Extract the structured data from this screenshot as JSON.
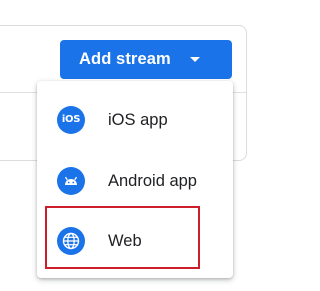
{
  "toolbar": {
    "add_stream_label": "Add stream",
    "add_stream_caret_icon": "arrow-drop-down-icon"
  },
  "menu": {
    "items": [
      {
        "label": "iOS app",
        "icon": "ios-icon",
        "icon_text": "iOS"
      },
      {
        "label": "Android app",
        "icon": "android-icon"
      },
      {
        "label": "Web",
        "icon": "globe-icon",
        "highlighted": true
      }
    ]
  },
  "colors": {
    "primary": "#1a73e8",
    "highlight_border": "#cc1f2a",
    "text": "#202124"
  }
}
